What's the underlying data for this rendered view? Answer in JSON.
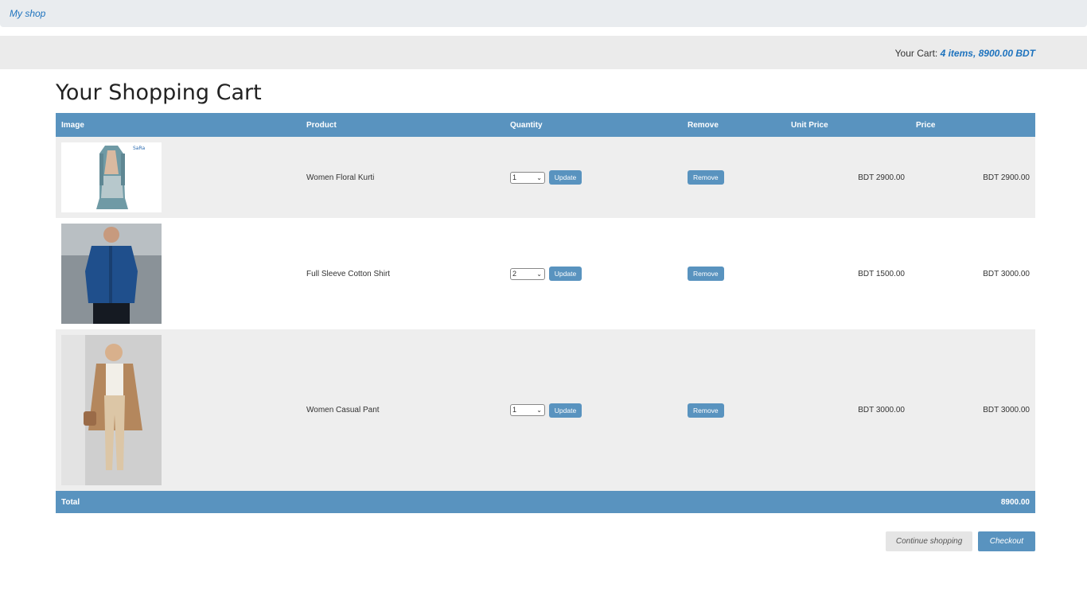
{
  "header": {
    "brand": "My shop"
  },
  "cart_summary": {
    "label": "Your Cart:",
    "value": "4 items, 8900.00 BDT"
  },
  "page_title": "Your Shopping Cart",
  "table": {
    "columns": [
      "Image",
      "Product",
      "Quantity",
      "Remove",
      "Unit Price",
      "Price"
    ],
    "rows": [
      {
        "product": "Women Floral Kurti",
        "quantity": "1",
        "update_label": "Update",
        "remove_label": "Remove",
        "unit_price": "BDT 2900.00",
        "price": "BDT 2900.00"
      },
      {
        "product": "Full Sleeve Cotton Shirt",
        "quantity": "2",
        "update_label": "Update",
        "remove_label": "Remove",
        "unit_price": "BDT 1500.00",
        "price": "BDT 3000.00"
      },
      {
        "product": "Women Casual Pant",
        "quantity": "1",
        "update_label": "Update",
        "remove_label": "Remove",
        "unit_price": "BDT 3000.00",
        "price": "BDT 3000.00"
      }
    ],
    "total_label": "Total",
    "total_value": "8900.00"
  },
  "actions": {
    "continue_label": "Continue shopping",
    "checkout_label": "Checkout"
  },
  "colors": {
    "accent": "#5993bf",
    "link": "#1e73be",
    "row_alt": "#eeeeee"
  }
}
